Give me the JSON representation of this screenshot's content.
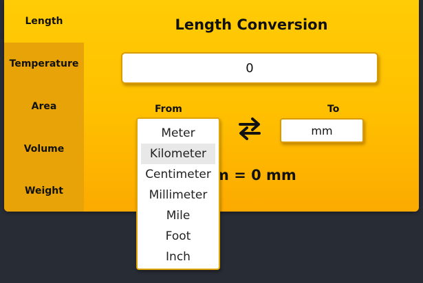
{
  "sidebar": {
    "tabs": [
      {
        "label": "Length",
        "active": true
      },
      {
        "label": "Temperature",
        "active": false
      },
      {
        "label": "Area",
        "active": false
      },
      {
        "label": "Volume",
        "active": false
      },
      {
        "label": "Weight",
        "active": false
      }
    ]
  },
  "main": {
    "title": "Length Conversion",
    "input_value": "0",
    "from_label": "From",
    "to_label": "To",
    "to_unit": "mm",
    "result_text": "m = 0 mm",
    "swap_icon": "swap-arrows-icon"
  },
  "dropdown": {
    "hovered": "Kilometer",
    "options": [
      "Meter",
      "Kilometer",
      "Centimeter",
      "Millimeter",
      "Mile",
      "Foot",
      "Inch"
    ]
  },
  "colors": {
    "accent": "#ffc107",
    "sidebar_inactive": "#e8a308",
    "background": "#282c35"
  }
}
